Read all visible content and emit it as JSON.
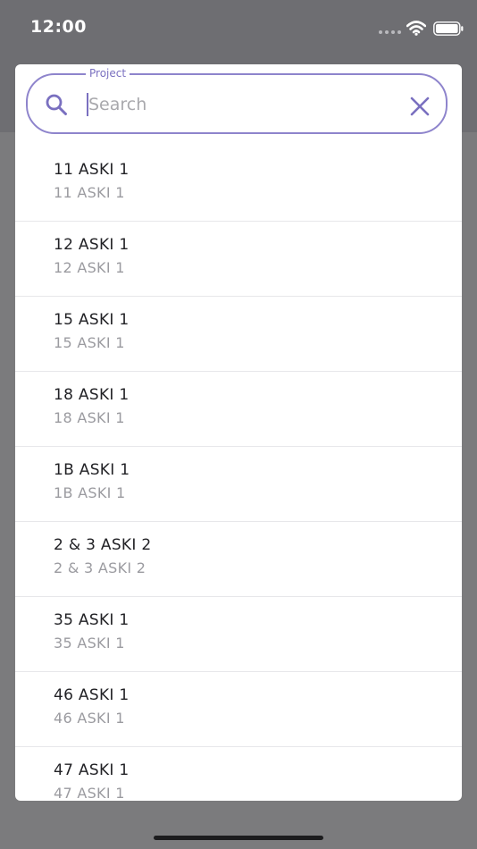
{
  "status_bar": {
    "time": "12:00"
  },
  "modal": {
    "search": {
      "legend": "Project",
      "placeholder": "Search",
      "value": ""
    },
    "items": [
      {
        "title": "11 ASKI 1",
        "subtitle": "11 ASKI 1"
      },
      {
        "title": "12 ASKI 1",
        "subtitle": "12 ASKI 1"
      },
      {
        "title": "15 ASKI 1",
        "subtitle": "15 ASKI 1"
      },
      {
        "title": "18 ASKI 1",
        "subtitle": "18 ASKI 1"
      },
      {
        "title": "1B ASKI 1",
        "subtitle": "1B ASKI 1"
      },
      {
        "title": "2 & 3 ASKI 2",
        "subtitle": "2 & 3 ASKI 2"
      },
      {
        "title": "35 ASKI 1",
        "subtitle": "35 ASKI 1"
      },
      {
        "title": "46 ASKI 1",
        "subtitle": "46 ASKI 1"
      },
      {
        "title": "47 ASKI 1",
        "subtitle": "47 ASKI 1"
      }
    ]
  },
  "icons": {
    "search": "search-icon",
    "clear": "close-icon",
    "wifi": "wifi-icon",
    "battery": "battery-icon"
  },
  "colors": {
    "accent": "#8e84cc",
    "backdrop": "#7b7b7d",
    "title_text": "#222226",
    "subtitle_text": "#9b9ba0"
  }
}
